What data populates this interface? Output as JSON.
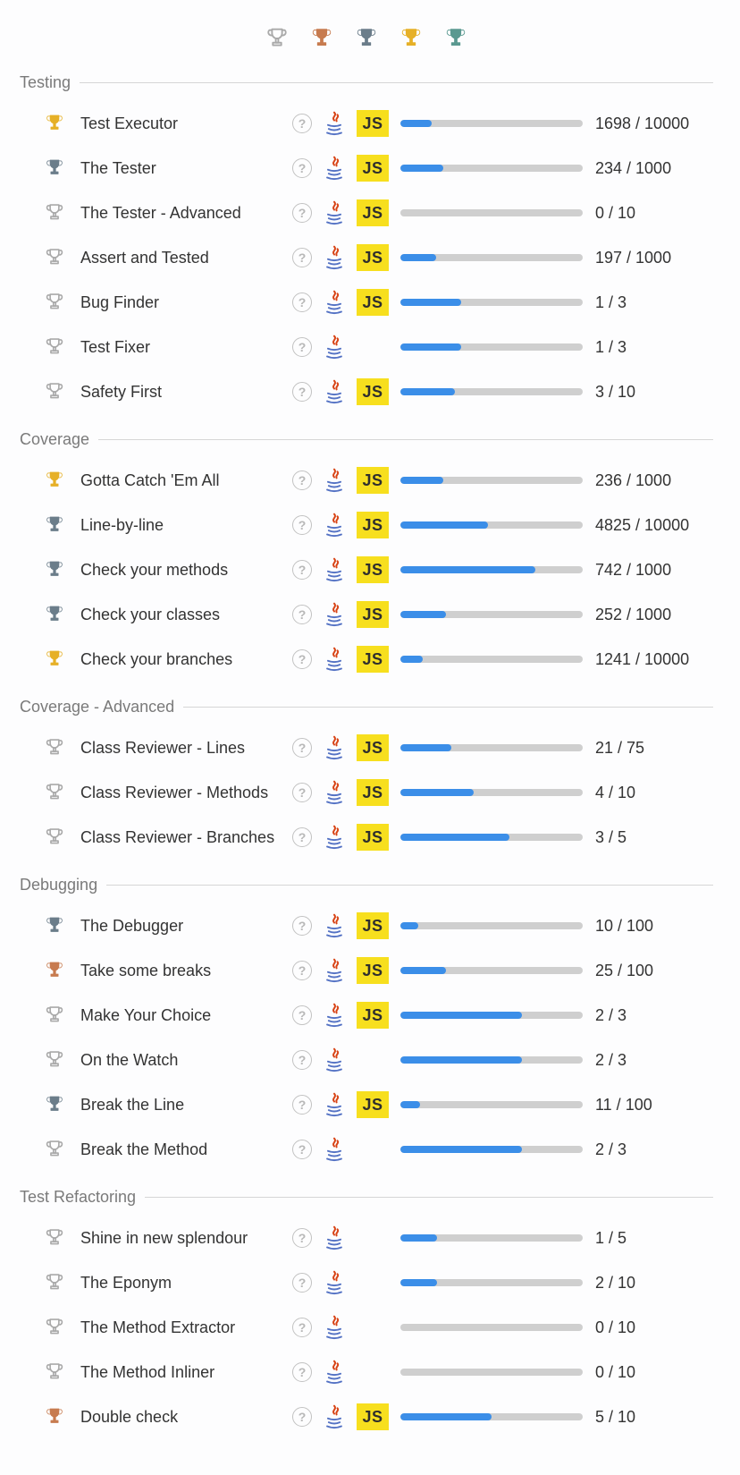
{
  "legend": {
    "trophies": [
      "none",
      "bronze",
      "slate",
      "gold",
      "teal"
    ]
  },
  "groups": [
    {
      "title": "Testing",
      "items": [
        {
          "trophy": "gold",
          "name": "Test Executor",
          "java": true,
          "js": true,
          "value": 1698,
          "max": 10000
        },
        {
          "trophy": "slate",
          "name": "The Tester",
          "java": true,
          "js": true,
          "value": 234,
          "max": 1000
        },
        {
          "trophy": "none",
          "name": "The Tester - Advanced",
          "java": true,
          "js": true,
          "value": 0,
          "max": 10
        },
        {
          "trophy": "none",
          "name": "Assert and Tested",
          "java": true,
          "js": true,
          "value": 197,
          "max": 1000
        },
        {
          "trophy": "none",
          "name": "Bug Finder",
          "java": true,
          "js": true,
          "value": 1,
          "max": 3
        },
        {
          "trophy": "none",
          "name": "Test Fixer",
          "java": true,
          "js": false,
          "value": 1,
          "max": 3
        },
        {
          "trophy": "none",
          "name": "Safety First",
          "java": true,
          "js": true,
          "value": 3,
          "max": 10
        }
      ]
    },
    {
      "title": "Coverage",
      "items": [
        {
          "trophy": "gold",
          "name": "Gotta Catch 'Em All",
          "java": true,
          "js": true,
          "value": 236,
          "max": 1000
        },
        {
          "trophy": "slate",
          "name": "Line-by-line",
          "java": true,
          "js": true,
          "value": 4825,
          "max": 10000
        },
        {
          "trophy": "slate",
          "name": "Check your methods",
          "java": true,
          "js": true,
          "value": 742,
          "max": 1000
        },
        {
          "trophy": "slate",
          "name": "Check your classes",
          "java": true,
          "js": true,
          "value": 252,
          "max": 1000
        },
        {
          "trophy": "gold",
          "name": "Check your branches",
          "java": true,
          "js": true,
          "value": 1241,
          "max": 10000
        }
      ]
    },
    {
      "title": "Coverage - Advanced",
      "items": [
        {
          "trophy": "none",
          "name": "Class Reviewer - Lines",
          "java": true,
          "js": true,
          "value": 21,
          "max": 75
        },
        {
          "trophy": "none",
          "name": "Class Reviewer - Methods",
          "java": true,
          "js": true,
          "value": 4,
          "max": 10
        },
        {
          "trophy": "none",
          "name": "Class Reviewer - Branches",
          "java": true,
          "js": true,
          "value": 3,
          "max": 5
        }
      ]
    },
    {
      "title": "Debugging",
      "items": [
        {
          "trophy": "slate",
          "name": "The Debugger",
          "java": true,
          "js": true,
          "value": 10,
          "max": 100
        },
        {
          "trophy": "bronze",
          "name": "Take some breaks",
          "java": true,
          "js": true,
          "value": 25,
          "max": 100
        },
        {
          "trophy": "none",
          "name": "Make Your Choice",
          "java": true,
          "js": true,
          "value": 2,
          "max": 3
        },
        {
          "trophy": "none",
          "name": "On the Watch",
          "java": true,
          "js": false,
          "value": 2,
          "max": 3
        },
        {
          "trophy": "slate",
          "name": "Break the Line",
          "java": true,
          "js": true,
          "value": 11,
          "max": 100
        },
        {
          "trophy": "none",
          "name": "Break the Method",
          "java": true,
          "js": false,
          "value": 2,
          "max": 3
        }
      ]
    },
    {
      "title": "Test Refactoring",
      "items": [
        {
          "trophy": "none",
          "name": "Shine in new splendour",
          "java": true,
          "js": false,
          "value": 1,
          "max": 5
        },
        {
          "trophy": "none",
          "name": "The Eponym",
          "java": true,
          "js": false,
          "value": 2,
          "max": 10
        },
        {
          "trophy": "none",
          "name": "The Method Extractor",
          "java": true,
          "js": false,
          "value": 0,
          "max": 10
        },
        {
          "trophy": "none",
          "name": "The Method Inliner",
          "java": true,
          "js": false,
          "value": 0,
          "max": 10
        },
        {
          "trophy": "bronze",
          "name": "Double check",
          "java": true,
          "js": true,
          "value": 5,
          "max": 10
        }
      ]
    }
  ],
  "trophy_colors": {
    "none": "#a9a9a9",
    "bronze": "#c77b4f",
    "slate": "#6b7d8a",
    "gold": "#e6b027",
    "teal": "#5a9990"
  },
  "js_label": "JS",
  "help_char": "?"
}
